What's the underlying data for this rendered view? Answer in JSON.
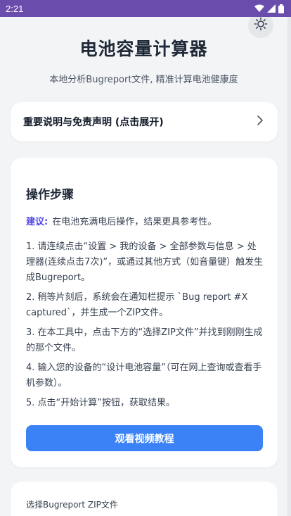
{
  "status_bar": {
    "time": "2:21"
  },
  "header": {
    "title": "电池容量计算器",
    "subtitle": "本地分析Bugreport文件, 精准计算电池健康度"
  },
  "disclaimer": {
    "label": "重要说明与免责声明 (点击展开)"
  },
  "steps": {
    "title": "操作步骤",
    "tip_label": "建议:",
    "tip_text": "在电池充满电后操作，结果更具参考性。",
    "items": [
      "1. 请连续点击“设置 > 我的设备 > 全部参数与信息 > 处理器(连续点击7次)”，或通过其他方式（如音量键）触发生成Bugreport。",
      "2. 稍等片刻后，系统会在通知栏提示 `Bug report #X captured`，并生成一个ZIP文件。",
      "3. 在本工具中，点击下方的“选择ZIP文件”并找到刚刚生成的那个文件。",
      "4. 输入您的设备的“设计电池容量”（可在网上查询或查看手机参数）。",
      "5. 点击“开始计算”按钮，获取结果。"
    ],
    "video_button": "观看视频教程"
  },
  "zip": {
    "label": "选择Bugreport ZIP文件"
  },
  "icons": {
    "theme": "sun-icon",
    "expand": "chevron-right-icon",
    "wifi": "wifi-icon",
    "signal": "signal-icon",
    "battery": "battery-icon"
  },
  "colors": {
    "status_bar": "#6a4cad",
    "accent": "#3b82f6",
    "tip_label": "#4f46e5",
    "background": "#f3f4f6"
  }
}
